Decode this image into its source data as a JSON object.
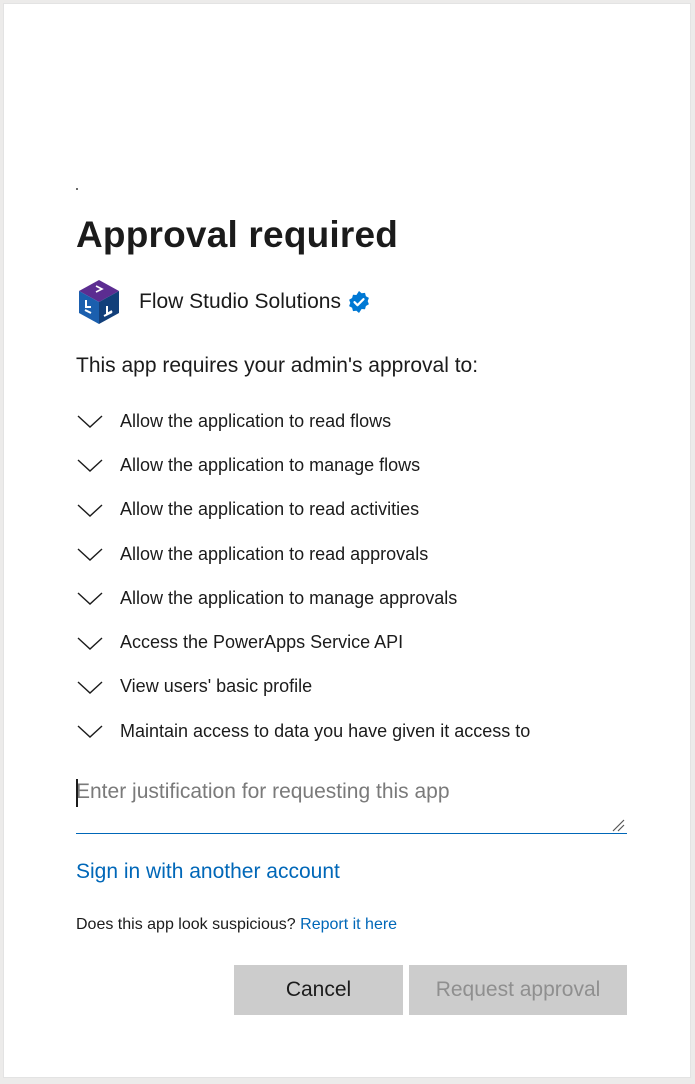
{
  "dialog": {
    "title": "Approval required",
    "app": {
      "name": "Flow Studio Solutions",
      "logo_icon": "flow-studio-cube-logo",
      "verified_icon": "verified-badge-icon",
      "verified_color": "#0078d4"
    },
    "intro": "This app requires your admin's approval to:",
    "permissions": [
      {
        "label": "Allow the application to read flows"
      },
      {
        "label": "Allow the application to manage flows"
      },
      {
        "label": "Allow the application to read activities"
      },
      {
        "label": "Allow the application to read approvals"
      },
      {
        "label": "Allow the application to manage approvals"
      },
      {
        "label": "Access the PowerApps Service API"
      },
      {
        "label": "View users' basic profile"
      },
      {
        "label": "Maintain access to data you have given it access to"
      }
    ],
    "justification": {
      "placeholder": "Enter justification for requesting this app",
      "value": ""
    },
    "sign_in_link": "Sign in with another account",
    "suspicious": {
      "text": "Does this app look suspicious?",
      "link": "Report it here"
    },
    "buttons": {
      "cancel": "Cancel",
      "request": "Request approval"
    }
  },
  "colors": {
    "accent": "#0067b8",
    "button_bg": "#cccccc",
    "disabled_text": "#8f8f8f",
    "logo_purple": "#5c2d91",
    "logo_blue": "#1b5fae"
  }
}
